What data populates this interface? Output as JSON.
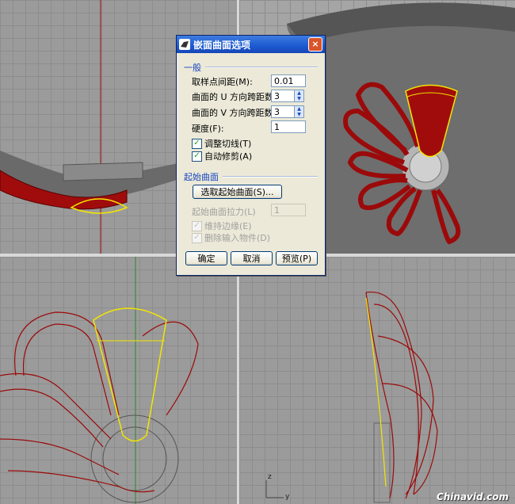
{
  "dialog": {
    "title": "嵌面曲面选项",
    "close_glyph": "×",
    "section_general": "一般",
    "sample_spacing_label": "取样点间距(M):",
    "sample_spacing_value": "0.01",
    "u_spans_label": "曲面的 U 方向跨距数:",
    "u_spans_value": "3",
    "v_spans_label": "曲面的 V 方向跨距数:",
    "v_spans_value": "3",
    "stiffness_label": "硬度(F):",
    "stiffness_value": "1",
    "adjust_tangency_label": "调整切线(T)",
    "adjust_tangency_checked": true,
    "auto_trim_label": "自动修剪(A)",
    "auto_trim_checked": true,
    "section_start_surface": "起始曲面",
    "select_start_surface_button": "选取起始曲面(S)...",
    "start_surface_pull_label": "起始曲面拉力(L)",
    "start_surface_pull_value": "1",
    "preserve_edges_label": "维持边缘(E)",
    "preserve_edges_checked": true,
    "delete_input_label": "删除输入物件(D)",
    "delete_input_checked": true,
    "ok_button": "确定",
    "cancel_button": "取消",
    "preview_button": "预览(P)"
  },
  "viewports": {
    "bottom_right_axis_z": "z",
    "bottom_right_axis_y": "y"
  },
  "watermark": "Chinavid.com",
  "colors": {
    "curve_red": "#9b0a0a",
    "highlight_yellow": "#f2e600",
    "titlebar_blue": "#1c5ad0",
    "grid_gray": "#9b9b9b"
  }
}
